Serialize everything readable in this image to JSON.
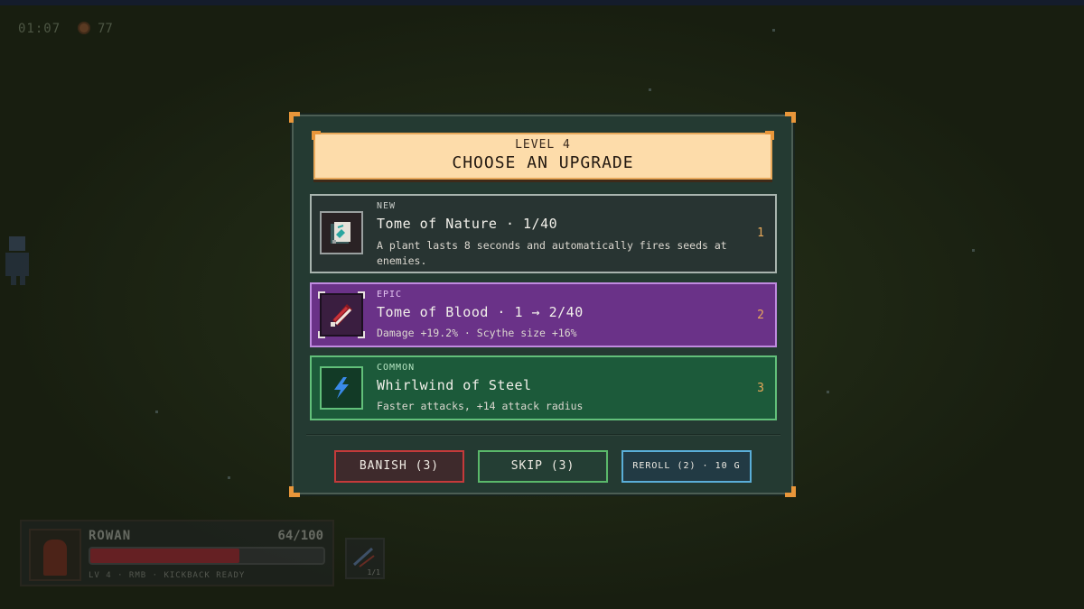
{
  "hud": {
    "timer": "01:07",
    "coins": "77"
  },
  "modal": {
    "level": "LEVEL 4",
    "title": "CHOOSE AN UPGRADE",
    "cards": [
      {
        "rarity": "NEW",
        "name": "Tome of Nature · 1/40",
        "description": "A plant lasts 8 seconds and automatically fires seeds at enemies.",
        "hotkey": "1",
        "icon": "nature-tome-icon",
        "color": "#283432"
      },
      {
        "rarity": "EPIC",
        "name": "Tome of Blood · 1 → 2/40",
        "description": "Damage +19.2% · Scythe size +16%",
        "hotkey": "2",
        "icon": "blood-tome-icon",
        "color": "#6a3288"
      },
      {
        "rarity": "COMMON",
        "name": "Whirlwind of Steel",
        "description": "Faster attacks, +14 attack radius",
        "hotkey": "3",
        "icon": "lightning-icon",
        "color": "#1c5a3a"
      }
    ],
    "buttons": {
      "banish": "BANISH (3)",
      "skip": "SKIP (3)",
      "reroll": "REROLL (2) · 10 G"
    }
  },
  "player": {
    "name": "ROWAN",
    "hp": "64/100",
    "hp_fraction": 0.64,
    "sub": "LV 4 · RMB · KICKBACK READY"
  },
  "ability": {
    "count": "1/1"
  },
  "colors": {
    "accent": "#e8963a",
    "header_bg": "#fddcaa",
    "banish": "#c43a3a",
    "skip": "#5ab86a",
    "reroll": "#5aaed8"
  }
}
